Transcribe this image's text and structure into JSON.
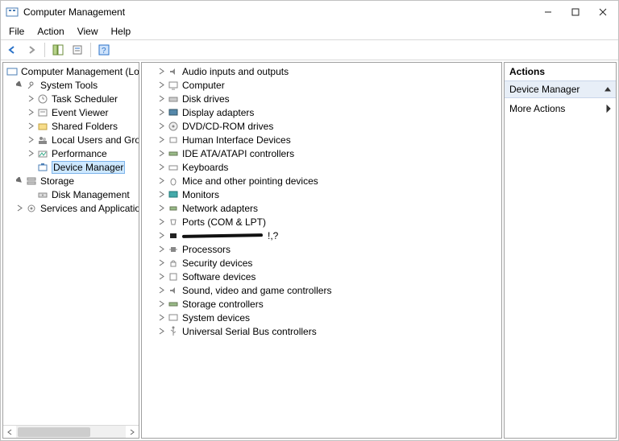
{
  "titlebar": {
    "title": "Computer Management"
  },
  "menu": {
    "file": "File",
    "action": "Action",
    "view": "View",
    "help": "Help"
  },
  "left_tree": {
    "root": "Computer Management (Local",
    "system_tools": {
      "label": "System Tools",
      "task_scheduler": "Task Scheduler",
      "event_viewer": "Event Viewer",
      "shared_folders": "Shared Folders",
      "local_users": "Local Users and Groups",
      "performance": "Performance",
      "device_manager": "Device Manager"
    },
    "storage": {
      "label": "Storage",
      "disk_management": "Disk Management"
    },
    "services": {
      "label": "Services and Applications"
    }
  },
  "devices": {
    "audio": "Audio inputs and outputs",
    "computer": "Computer",
    "disk": "Disk drives",
    "display": "Display adapters",
    "dvd": "DVD/CD-ROM drives",
    "hid": "Human Interface Devices",
    "ide": "IDE ATA/ATAPI controllers",
    "keyboards": "Keyboards",
    "mice": "Mice and other pointing devices",
    "monitors": "Monitors",
    "network": "Network adapters",
    "ports": "Ports (COM & LPT)",
    "redacted_suffix": "!,?",
    "processors": "Processors",
    "security": "Security devices",
    "software": "Software devices",
    "sound": "Sound, video and game controllers",
    "storage_ctrl": "Storage controllers",
    "system": "System devices",
    "usb": "Universal Serial Bus controllers"
  },
  "actions": {
    "header": "Actions",
    "subheader": "Device Manager",
    "more": "More Actions"
  }
}
